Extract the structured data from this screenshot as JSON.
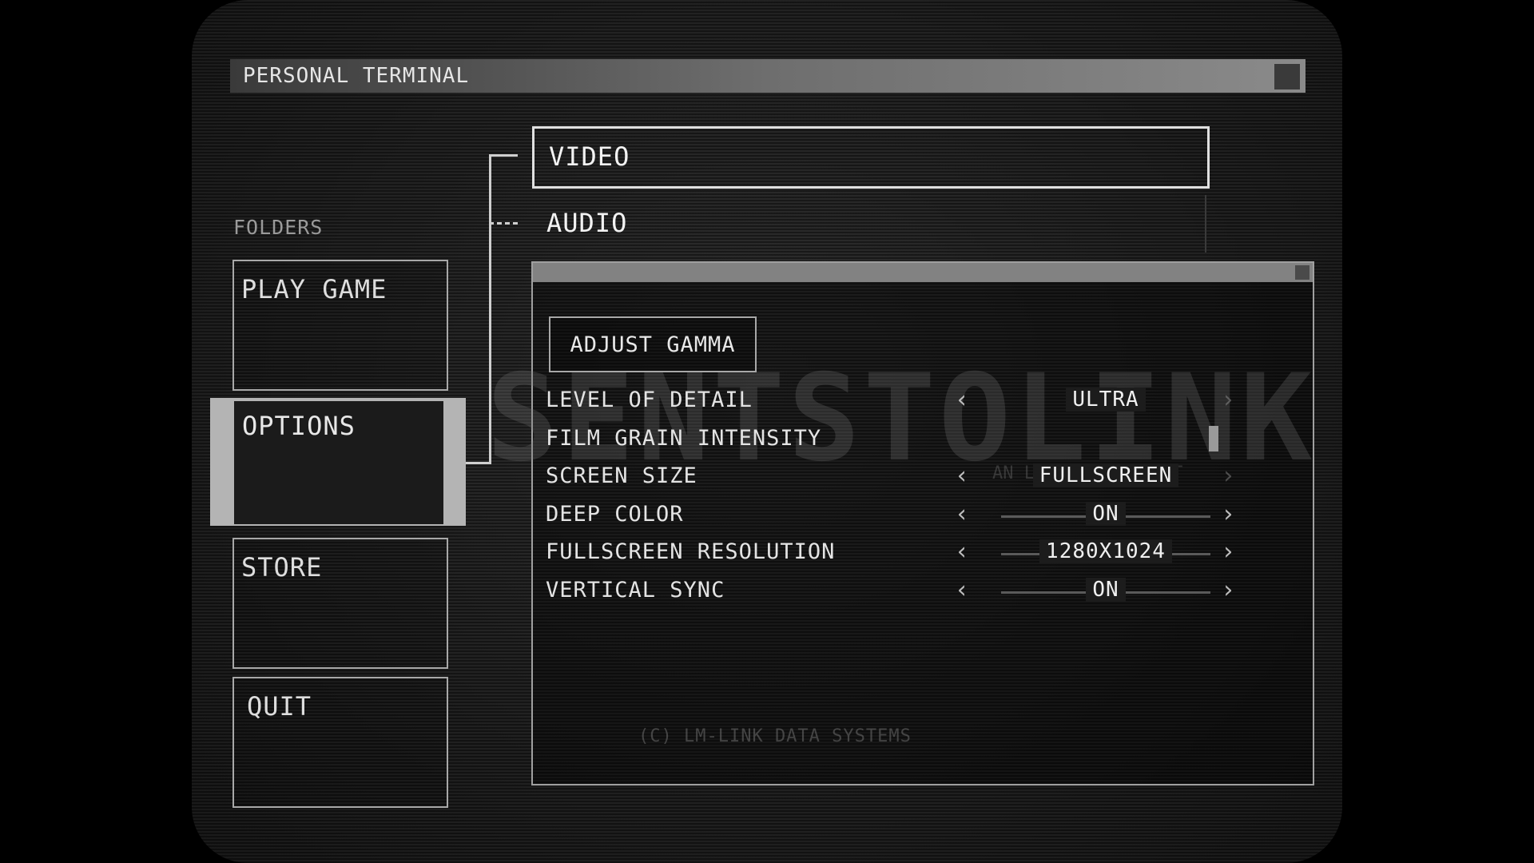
{
  "window": {
    "title": "PERSONAL TERMINAL"
  },
  "folders": {
    "label": "FOLDERS",
    "items": [
      {
        "label": "PLAY GAME"
      },
      {
        "label": "OPTIONS",
        "active": true
      },
      {
        "label": "STORE"
      },
      {
        "label": "QUIT"
      }
    ]
  },
  "tabs": [
    {
      "label": "VIDEO",
      "selected": true
    },
    {
      "label": "AUDIO",
      "selected": false
    }
  ],
  "panel": {
    "watermark": "SENTSTOLINK",
    "watermark_sub": "AN LM-LINK PRODUCT",
    "gamma_button": "ADJUST GAMMA",
    "settings": [
      {
        "label": "LEVEL OF DETAIL",
        "value": "ULTRA"
      },
      {
        "label": "FILM GRAIN INTENSITY",
        "value": ""
      },
      {
        "label": "SCREEN SIZE",
        "value": "FULLSCREEN"
      },
      {
        "label": "DEEP COLOR",
        "value": "ON"
      },
      {
        "label": "FULLSCREEN RESOLUTION",
        "value": "1280X1024"
      },
      {
        "label": "VERTICAL SYNC",
        "value": "ON"
      }
    ],
    "copyright": "(C) LM-LINK DATA SYSTEMS"
  },
  "icons": {
    "left_arrow": "chevron-left-icon",
    "right_arrow": "chevron-right-icon"
  },
  "colors": {
    "background": "#1e1e1e",
    "frame": "#a8a8a8",
    "active_folder": "#b4b4b4",
    "title_bar": "#6e6e6e"
  }
}
